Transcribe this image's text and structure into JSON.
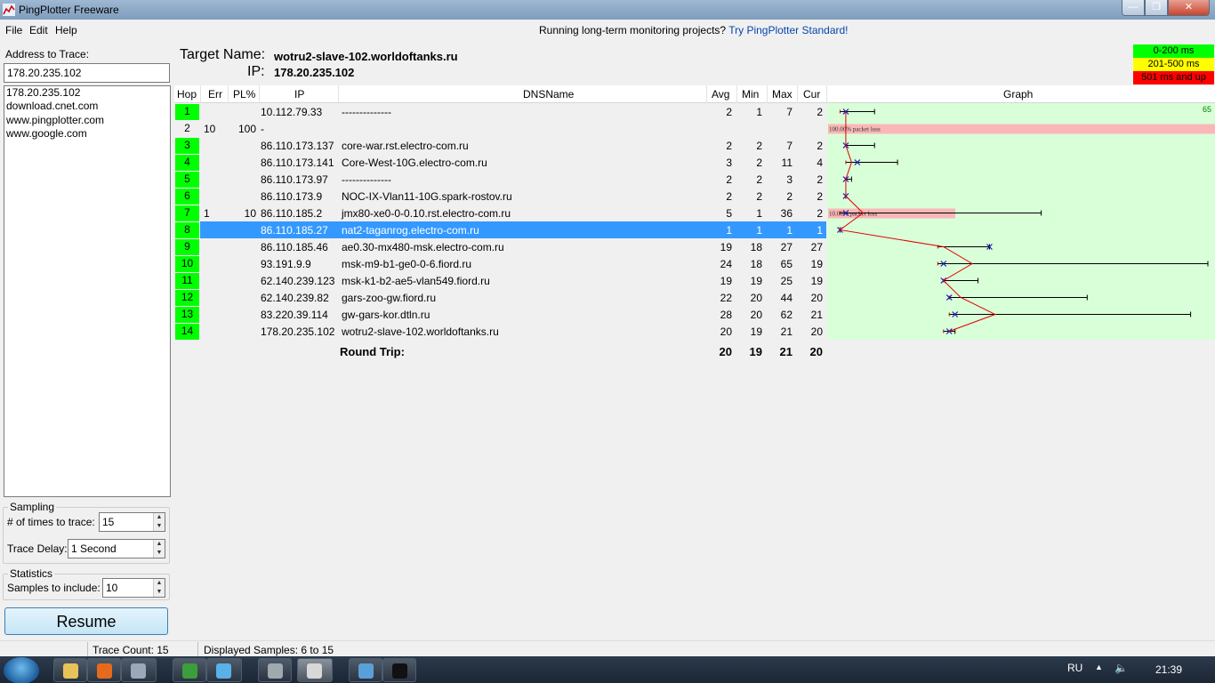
{
  "window": {
    "title": "PingPlotter Freeware"
  },
  "menu": [
    "File",
    "Edit",
    "Help"
  ],
  "promo": {
    "text": "Running long-term monitoring projects? ",
    "link": "Try PingPlotter Standard!"
  },
  "left": {
    "address_label": "Address to Trace:",
    "address_value": "178.20.235.102",
    "history": [
      "178.20.235.102",
      "download.cnet.com",
      "www.pingplotter.com",
      "www.google.com"
    ],
    "sampling_title": "Sampling",
    "times_label": "# of times to trace:",
    "times_value": "15",
    "delay_label": "Trace Delay:",
    "delay_value": "1 Second",
    "statistics_title": "Statistics",
    "samples_label": "Samples to include:",
    "samples_value": "10",
    "resume_label": "Resume"
  },
  "target": {
    "name_label": "Target Name:",
    "name_value": "wotru2-slave-102.worldoftanks.ru",
    "ip_label": "IP:",
    "ip_value": "178.20.235.102"
  },
  "legend": [
    {
      "label": "0-200 ms",
      "color": "#00ff00",
      "text_color": "#000000"
    },
    {
      "label": "201-500 ms",
      "color": "#ffff00",
      "text_color": "#000000"
    },
    {
      "label": "501 ms and up",
      "color": "#ff0000",
      "text_color": "#000000"
    }
  ],
  "columns": [
    "Hop",
    "Err",
    "PL%",
    "IP",
    "DNSName",
    "Avg",
    "Min",
    "Max",
    "Cur",
    "Graph"
  ],
  "hops": [
    {
      "hop": "1",
      "err": "",
      "pl": "",
      "ip": "10.112.79.33",
      "dns": "--------------",
      "avg": "2",
      "min": "1",
      "max": "7",
      "cur": "2",
      "status": "green"
    },
    {
      "hop": "2",
      "err": "10",
      "pl": "100",
      "ip": "-",
      "dns": "",
      "avg": "",
      "min": "",
      "max": "",
      "cur": "",
      "status": "none",
      "loss_label": "100.00% packet loss",
      "loss_pct": 100
    },
    {
      "hop": "3",
      "err": "",
      "pl": "",
      "ip": "86.110.173.137",
      "dns": "core-war.rst.electro-com.ru",
      "avg": "2",
      "min": "2",
      "max": "7",
      "cur": "2",
      "status": "green"
    },
    {
      "hop": "4",
      "err": "",
      "pl": "",
      "ip": "86.110.173.141",
      "dns": "Core-West-10G.electro-com.ru",
      "avg": "3",
      "min": "2",
      "max": "11",
      "cur": "4",
      "status": "green"
    },
    {
      "hop": "5",
      "err": "",
      "pl": "",
      "ip": "86.110.173.97",
      "dns": "--------------",
      "avg": "2",
      "min": "2",
      "max": "3",
      "cur": "2",
      "status": "green"
    },
    {
      "hop": "6",
      "err": "",
      "pl": "",
      "ip": "86.110.173.9",
      "dns": "NOC-IX-Vlan11-10G.spark-rostov.ru",
      "avg": "2",
      "min": "2",
      "max": "2",
      "cur": "2",
      "status": "green"
    },
    {
      "hop": "7",
      "err": "1",
      "pl": "10",
      "ip": "86.110.185.2",
      "dns": "jmx80-xe0-0-0.10.rst.electro-com.ru",
      "avg": "5",
      "min": "1",
      "max": "36",
      "cur": "2",
      "status": "green",
      "loss_label": "10.00% packet loss",
      "loss_pct": 10
    },
    {
      "hop": "8",
      "err": "",
      "pl": "",
      "ip": "86.110.185.27",
      "dns": "nat2-taganrog.electro-com.ru",
      "avg": "1",
      "min": "1",
      "max": "1",
      "cur": "1",
      "status": "green",
      "selected": true
    },
    {
      "hop": "9",
      "err": "",
      "pl": "",
      "ip": "86.110.185.46",
      "dns": "ae0.30-mx480-msk.electro-com.ru",
      "avg": "19",
      "min": "18",
      "max": "27",
      "cur": "27",
      "status": "green"
    },
    {
      "hop": "10",
      "err": "",
      "pl": "",
      "ip": "93.191.9.9",
      "dns": "msk-m9-b1-ge0-0-6.fiord.ru",
      "avg": "24",
      "min": "18",
      "max": "65",
      "cur": "19",
      "status": "green"
    },
    {
      "hop": "11",
      "err": "",
      "pl": "",
      "ip": "62.140.239.123",
      "dns": "msk-k1-b2-ae5-vlan549.fiord.ru",
      "avg": "19",
      "min": "19",
      "max": "25",
      "cur": "19",
      "status": "green"
    },
    {
      "hop": "12",
      "err": "",
      "pl": "",
      "ip": "62.140.239.82",
      "dns": "gars-zoo-gw.fiord.ru",
      "avg": "22",
      "min": "20",
      "max": "44",
      "cur": "20",
      "status": "green"
    },
    {
      "hop": "13",
      "err": "",
      "pl": "",
      "ip": "83.220.39.114",
      "dns": "gw-gars-kor.dtln.ru",
      "avg": "28",
      "min": "20",
      "max": "62",
      "cur": "21",
      "status": "green"
    },
    {
      "hop": "14",
      "err": "",
      "pl": "",
      "ip": "178.20.235.102",
      "dns": "wotru2-slave-102.worldoftanks.ru",
      "avg": "20",
      "min": "19",
      "max": "21",
      "cur": "20",
      "status": "green"
    }
  ],
  "graph": {
    "scale_label": "65",
    "scale_max_ms": 65,
    "background": "#d9ffd9"
  },
  "round_trip": {
    "label": "Round Trip:",
    "avg": "20",
    "min": "19",
    "max": "21",
    "cur": "20"
  },
  "status": {
    "trace_count": "Trace Count: 15",
    "displayed_samples": "Displayed Samples: 6 to 15"
  },
  "taskbar": {
    "apps": [
      {
        "name": "explorer",
        "color": "#e8c35a"
      },
      {
        "name": "firefox",
        "color": "#e66a1c"
      },
      {
        "name": "pc-app",
        "color": "#9aa8b8"
      },
      {
        "name": "green-app",
        "color": "#3c9d3c"
      },
      {
        "name": "network-app",
        "color": "#5ab0e8"
      },
      {
        "name": "wings-app",
        "color": "#a0a8b0"
      },
      {
        "name": "pingplotter",
        "color": "#d8d8d8"
      },
      {
        "name": "monitor-app",
        "color": "#5aa0d8"
      },
      {
        "name": "console",
        "color": "#111111"
      }
    ],
    "language": "RU",
    "clock": "21:39"
  }
}
